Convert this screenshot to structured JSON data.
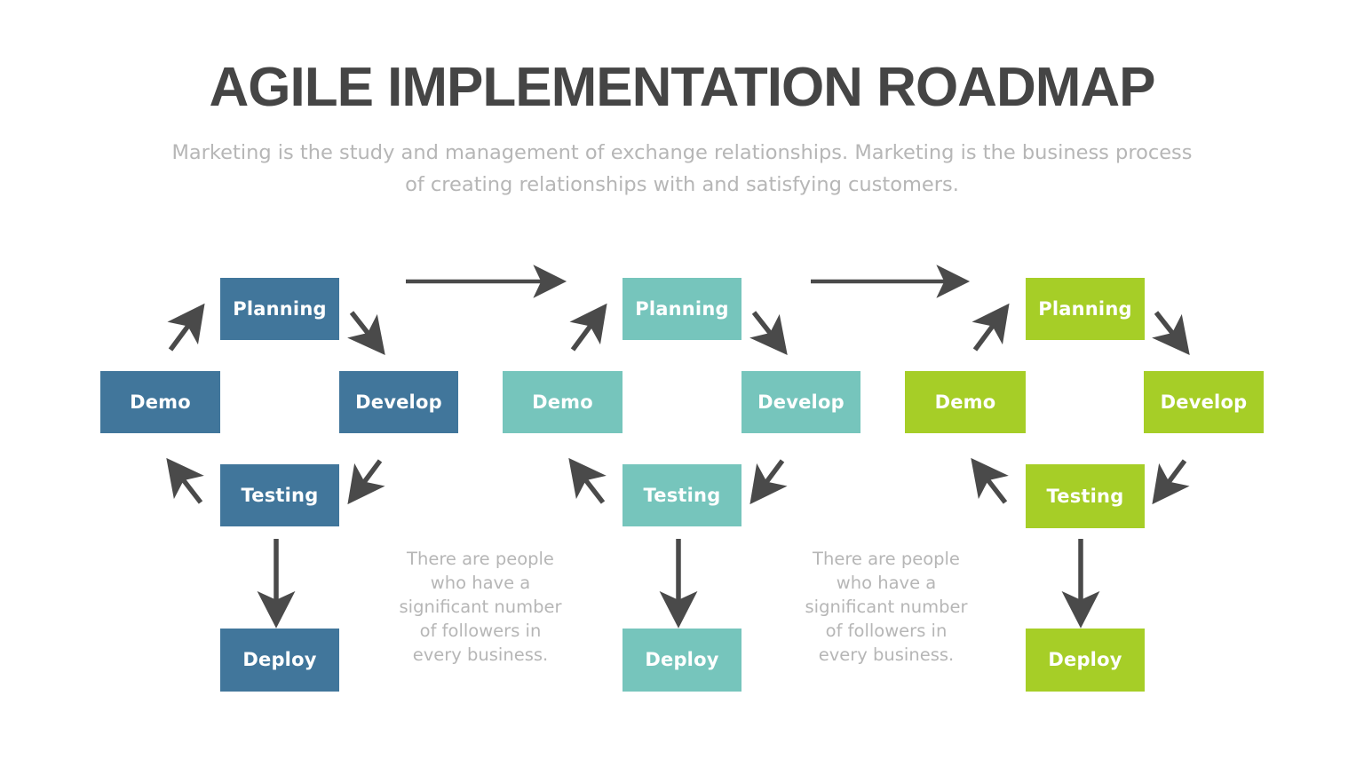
{
  "header": {
    "title": "AGILE IMPLEMENTATION ROADMAP",
    "subtitle": "Marketing is the study and management of exchange relationships. Marketing is the business process of creating relationships with and satisfying customers.",
    "title_color": "#454545",
    "subtitle_color": "#b6b6b6"
  },
  "palette": {
    "cycle1": "#41769b",
    "cycle2": "#76c5bc",
    "cycle3": "#a6ce27",
    "arrow": "#4a4a4a",
    "node_label": "#ffffff"
  },
  "cycles": [
    {
      "name": "cycle-one",
      "color": "#41769b",
      "nodes": {
        "planning": "Planning",
        "develop": "Develop",
        "testing": "Testing",
        "demo": "Demo",
        "deploy": "Deploy"
      }
    },
    {
      "name": "cycle-two",
      "color": "#76c5bc",
      "nodes": {
        "planning": "Planning",
        "develop": "Develop",
        "testing": "Testing",
        "demo": "Demo",
        "deploy": "Deploy"
      }
    },
    {
      "name": "cycle-three",
      "color": "#a6ce27",
      "nodes": {
        "planning": "Planning",
        "develop": "Develop",
        "testing": "Testing",
        "demo": "Demo",
        "deploy": "Deploy"
      }
    }
  ],
  "captions": [
    {
      "text": "There are people who have a significant number of followers in every business."
    },
    {
      "text": "There are people who have a significant number of followers in every business."
    }
  ],
  "connectors": {
    "stage_arrow_1": "stage-arrow-right",
    "stage_arrow_2": "stage-arrow-right"
  }
}
